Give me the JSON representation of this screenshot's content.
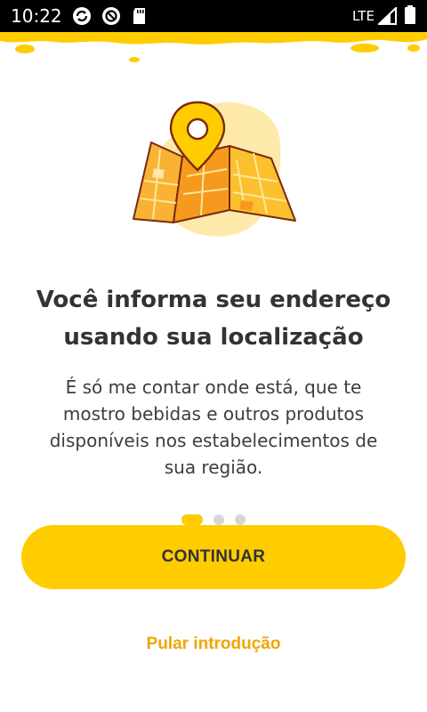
{
  "status_bar": {
    "time": "10:22",
    "network": "LTE",
    "icons": [
      "sync-icon",
      "do-not-disturb-icon",
      "sd-card-icon",
      "signal-icon",
      "battery-icon"
    ]
  },
  "onboarding": {
    "illustration": "map-location-pin-illustration",
    "headline": {
      "line1": "Você informa seu endereço",
      "line2": "usando sua localização"
    },
    "description": {
      "line1": "É só me contar onde está, que te",
      "line2": "mostro bebidas e outros produtos",
      "line3": "disponíveis nos estabelecimentos de",
      "line4": "sua região."
    },
    "pager": {
      "total_pages": 3,
      "active_page": 1
    },
    "continue_label": "CONTINUAR",
    "skip_label": "Pular introdução"
  },
  "colors": {
    "accent": "#ffcc00",
    "skip_text": "#f0a500",
    "heading_text": "#333333",
    "body_text": "#3d3d3d",
    "dot_inactive": "#d6d6d6",
    "status_bar": "#000000"
  }
}
